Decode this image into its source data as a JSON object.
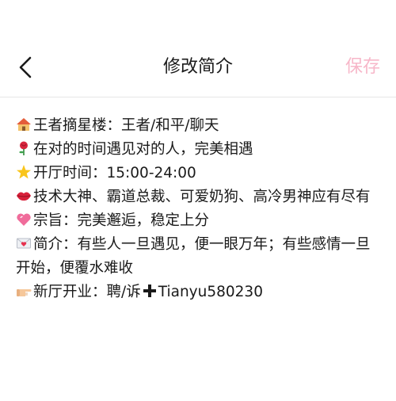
{
  "header": {
    "title": "修改简介",
    "save_label": "保存",
    "save_color": "#f7b7c9"
  },
  "content": {
    "lines": [
      {
        "icon": "house-icon",
        "text": "王者摘星楼：王者/和平/聊天"
      },
      {
        "icon": "rose-icon",
        "text": "在对的时间遇见对的人，完美相遇"
      },
      {
        "icon": "star-icon",
        "text": "开厅时间：15:00-24:00"
      },
      {
        "icon": "lips-icon",
        "text": "技术大神、霸道总裁、可爱奶狗、高冷男神应有尽有"
      },
      {
        "icon": "heart-icon",
        "text": "宗旨：完美邂逅，稳定上分"
      },
      {
        "icon": "love-letter-icon",
        "text": "简介：有些人一旦遇见，便一眼万年；有些感情一旦开始，便覆水难收"
      },
      {
        "icon": "pointing-hand-icon",
        "text_before": "新厅开业：聘/诉",
        "plus_icon": "plus-icon",
        "text_after": "Tianyu580230"
      }
    ]
  }
}
